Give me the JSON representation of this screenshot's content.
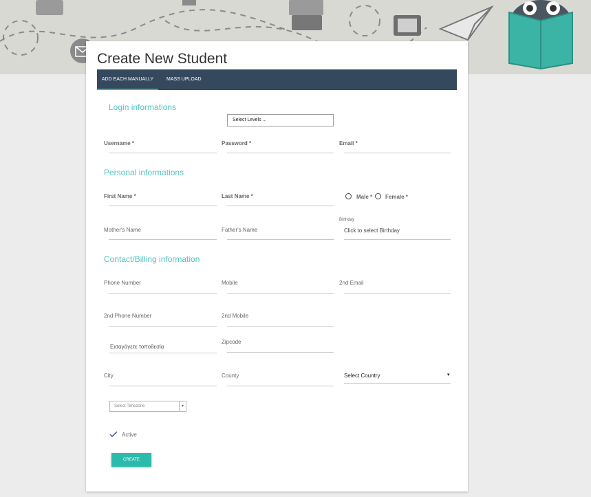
{
  "page": {
    "title": "Create New Student"
  },
  "tabs": [
    {
      "label": "ADD EACH MANUALLY",
      "active": true
    },
    {
      "label": "MASS UPLOAD",
      "active": false
    }
  ],
  "sections": {
    "login": "Login informations",
    "personal": "Personal informations",
    "contact": "Contact/Billing information"
  },
  "fields": {
    "levels_select": "Select Levels ...",
    "username": "Username *",
    "password": "Password *",
    "email": "Email *",
    "first_name": "First Name *",
    "last_name": "Last Name *",
    "male": "Male *",
    "female": "Female *",
    "mothers_name": "Mother's Name",
    "fathers_name": "Father's Name",
    "birthday_label": "Birthday",
    "birthday_placeholder": "Click to select Birthday",
    "phone": "Phone Number",
    "mobile": "Mobile",
    "second_email": "2nd Email",
    "second_phone": "2nd Phone Number",
    "second_mobile": "2nd Mobile",
    "location_placeholder": "Εισαγάγετε τοποθεσία",
    "zipcode": "Zipcode",
    "city": "City",
    "county": "County",
    "country_select": "Select Country",
    "timezone_select": "Select Timezone",
    "active": "Active"
  },
  "actions": {
    "create": "CREATE"
  },
  "colors": {
    "accent": "#2bbbad",
    "tabbar": "#34495e",
    "section_text": "#55c3c1"
  }
}
